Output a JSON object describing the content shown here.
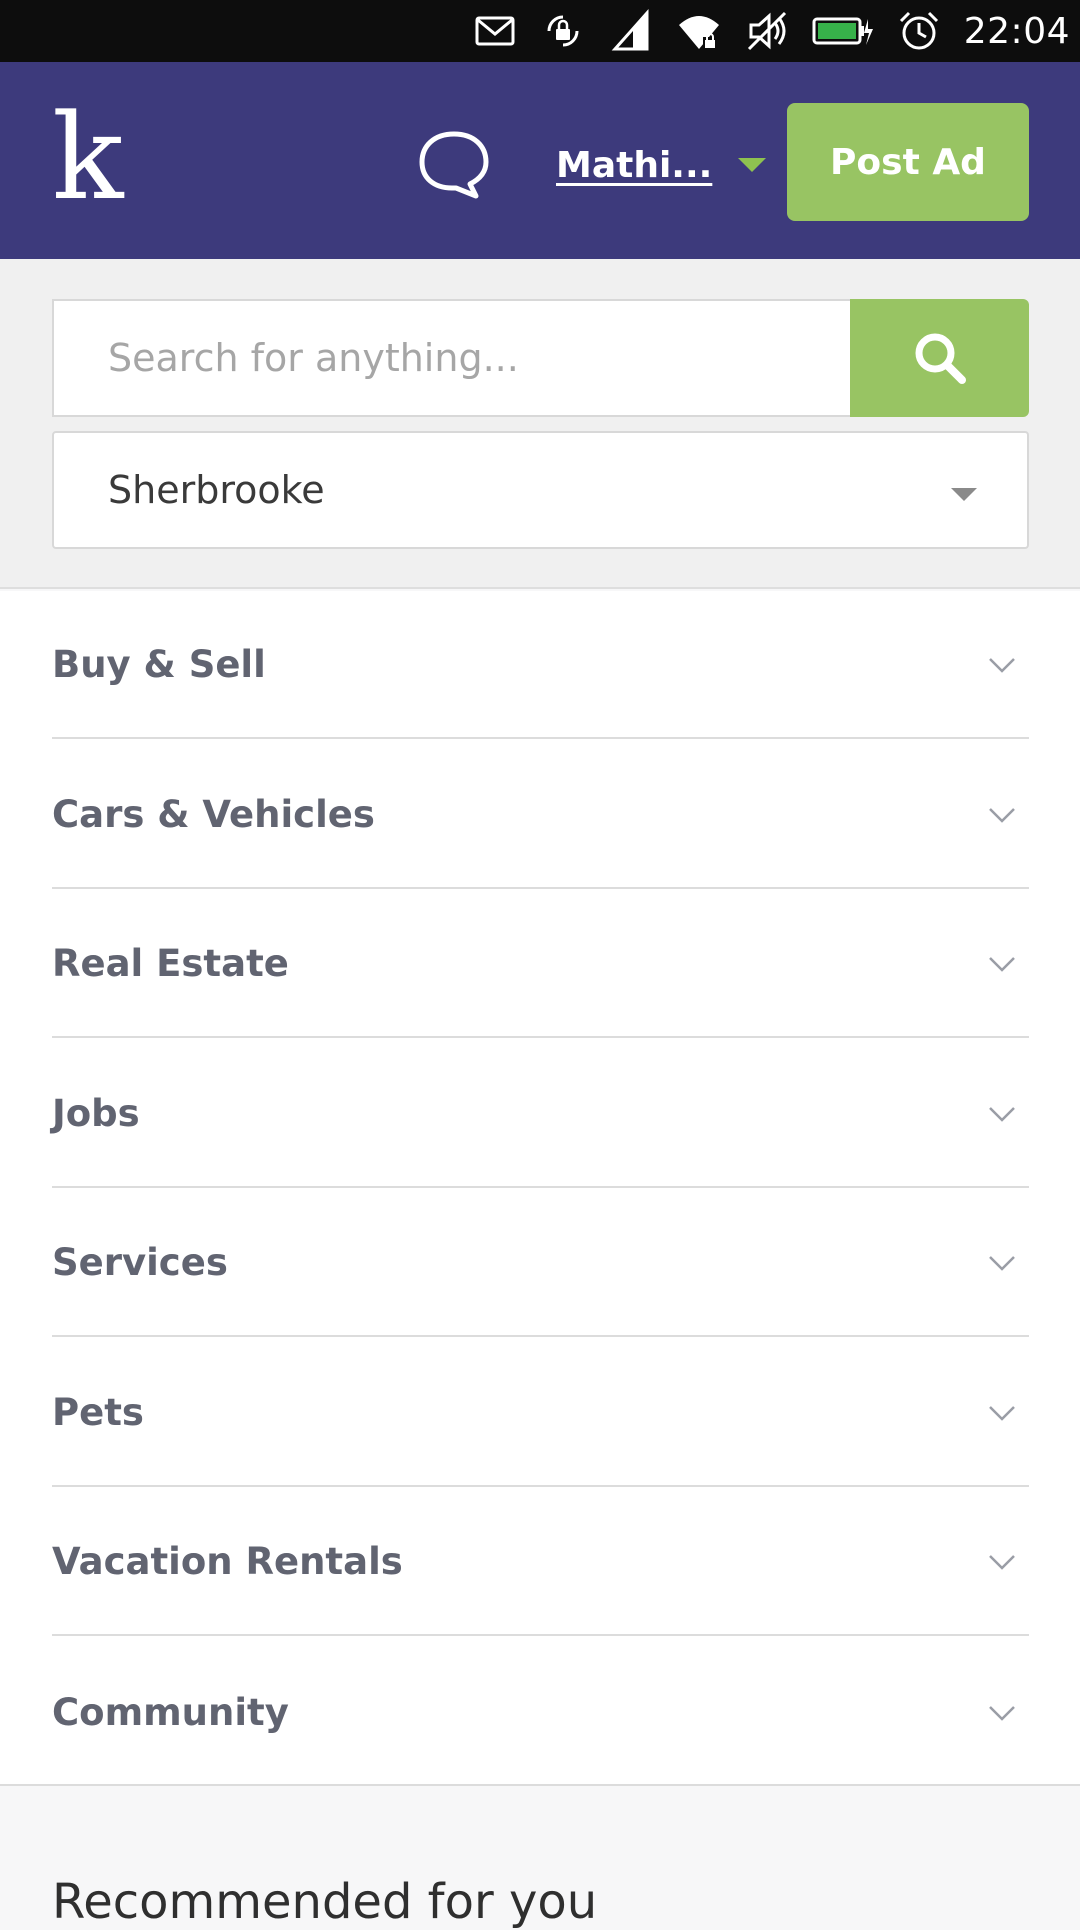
{
  "status_bar": {
    "time": "22:04",
    "icons": [
      "mail-icon",
      "screen-rotation-lock-icon",
      "signal-icon",
      "wifi-icon",
      "mute-icon",
      "battery-charging-icon",
      "alarm-icon"
    ]
  },
  "header": {
    "logo": "k",
    "user_name": "Mathi...",
    "post_ad_label": "Post Ad"
  },
  "search": {
    "placeholder": "Search for anything...",
    "value": "",
    "location": "Sherbrooke"
  },
  "categories": [
    {
      "label": "Buy & Sell"
    },
    {
      "label": "Cars & Vehicles"
    },
    {
      "label": "Real Estate"
    },
    {
      "label": "Jobs"
    },
    {
      "label": "Services"
    },
    {
      "label": "Pets"
    },
    {
      "label": "Vacation Rentals"
    },
    {
      "label": "Community"
    }
  ],
  "recommended": {
    "title": "Recommended for you"
  },
  "colors": {
    "header_bg": "#3d3a7c",
    "accent_green": "#98c463",
    "status_bar_bg": "#0d0d0d"
  }
}
